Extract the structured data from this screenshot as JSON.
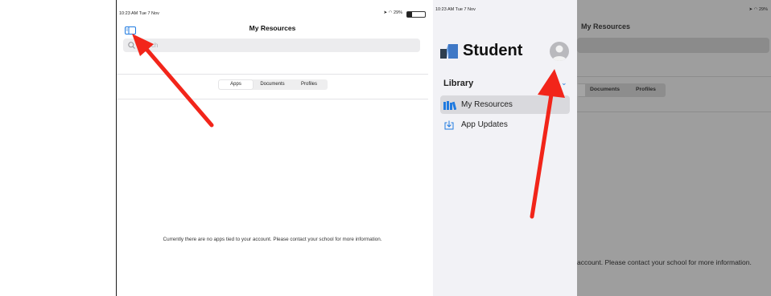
{
  "left": {
    "status_time": "10:23 AM  Tue 7 Nov",
    "status_battery": "29%",
    "title": "My Resources",
    "search_placeholder": "Search",
    "tabs": [
      {
        "label": "Apps"
      },
      {
        "label": "Documents"
      },
      {
        "label": "Profiles"
      }
    ],
    "empty_message": "Currently there are no apps tied to your account. Please contact your school for more information."
  },
  "right": {
    "status_time": "10:23 AM  Tue 7 Nov",
    "status_battery": "29%",
    "app_name": "Student",
    "section_label": "Library",
    "items": [
      {
        "label": "My Resources"
      },
      {
        "label": "App Updates"
      }
    ],
    "bg_title": "My Resources",
    "bg_tabs": [
      {
        "label": "Documents"
      },
      {
        "label": "Profiles"
      }
    ],
    "bg_message": "account. Please contact your school for more information."
  },
  "colors": {
    "accent": "#1f7ae0",
    "arrow": "#f2251a",
    "dim_overlay": "#9e9e9e"
  }
}
